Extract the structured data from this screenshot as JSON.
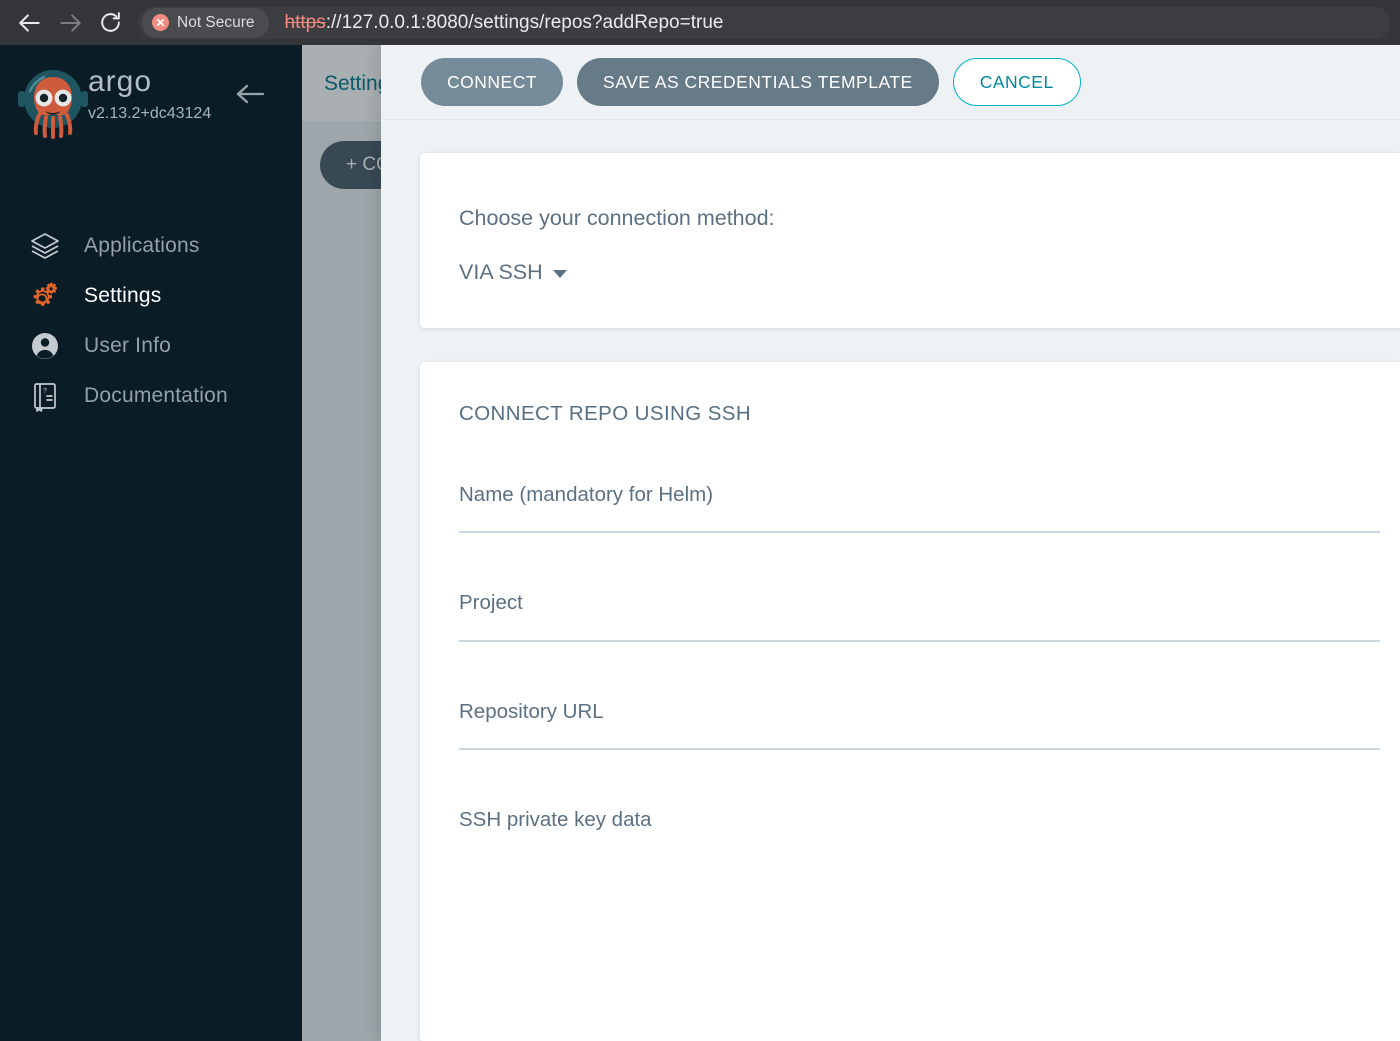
{
  "browser": {
    "back_icon": "arrow-left-icon",
    "forward_icon": "arrow-right-icon",
    "reload_icon": "reload-icon",
    "security_label": "Not Secure",
    "security_icon": "not-secure-icon",
    "url_scheme": "https",
    "url_rest": "://127.0.0.1:8080/settings/repos?addRepo=true"
  },
  "sidebar": {
    "brand_name": "argo",
    "version": "v2.13.2+dc43124",
    "collapse_icon": "arrow-left-icon",
    "logo_icon": "argo-octopus-logo",
    "items": [
      {
        "label": "Applications",
        "icon": "layers-icon",
        "active": false
      },
      {
        "label": "Settings",
        "icon": "gears-icon",
        "active": true
      },
      {
        "label": "User Info",
        "icon": "user-circle-icon",
        "active": false
      },
      {
        "label": "Documentation",
        "icon": "book-icon",
        "active": false
      }
    ]
  },
  "background_page": {
    "breadcrumb": "Settings",
    "connect_repo_button": "+ CONNECT REPO"
  },
  "panel": {
    "toolbar": {
      "connect_label": "CONNECT",
      "save_template_label": "SAVE AS CREDENTIALS TEMPLATE",
      "cancel_label": "CANCEL"
    },
    "method_card": {
      "prompt": "Choose your connection method:",
      "selected": "VIA SSH",
      "caret_icon": "chevron-down-icon"
    },
    "form_card": {
      "title": "CONNECT REPO USING SSH",
      "fields": [
        {
          "label": "Name (mandatory for Helm)",
          "value": "",
          "type": "text"
        },
        {
          "label": "Project",
          "value": "",
          "type": "text"
        },
        {
          "label": "Repository URL",
          "value": "",
          "type": "text"
        },
        {
          "label": "SSH private key data",
          "value": "",
          "type": "textarea"
        }
      ]
    }
  },
  "colors": {
    "sidebar_bg": "#0a1d26",
    "accent_orange": "#e2662a",
    "accent_teal": "#00899e",
    "panel_bg": "#eef2f5",
    "button_slate": "#768b99",
    "field_underline": "#ccd6e0"
  }
}
